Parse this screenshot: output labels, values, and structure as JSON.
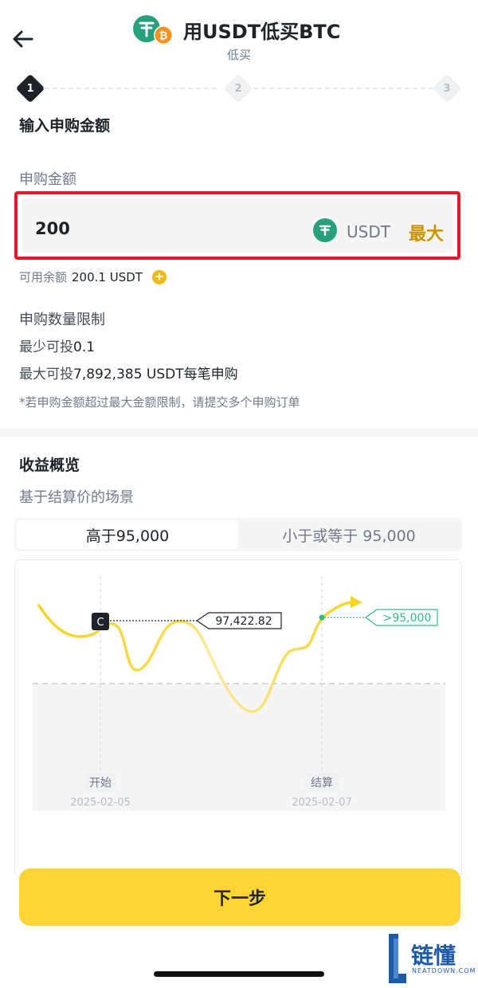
{
  "header": {
    "title": "用USDT低买BTC",
    "subtitle": "低买"
  },
  "stepper": {
    "steps": [
      "1",
      "2",
      "3"
    ],
    "active_step": 1
  },
  "form": {
    "section_title": "输入申购金额",
    "amount_label": "申购金额",
    "amount_value": "200",
    "currency": "USDT",
    "max_label": "最大",
    "available_label": "可用余额",
    "available_value": "200.1 USDT"
  },
  "limits": {
    "title": "申购数量限制",
    "min_label": "最少可投",
    "min_value": "0.1",
    "max_label": "最大可投",
    "max_value": "7,892,385 USDT每笔申购",
    "note": "*若申购金额超过最大金额限制，请提交多个申购订单"
  },
  "returns": {
    "title": "收益概览",
    "subtitle": "基于结算价的场景",
    "tabs": [
      "高于95,000",
      "小于或等于 95,000"
    ],
    "active_tab": 0
  },
  "chart_data": {
    "type": "line",
    "marker_label": "C",
    "price_label": "97,422.82",
    "target_label": ">95,000",
    "start_label": "开始",
    "start_date": "2025-02-05",
    "settle_label": "结算",
    "settle_date": "2025-02-07",
    "colors": {
      "line": "#f7d93e",
      "target": "#2ebd85",
      "threshold": "#c8ccd2"
    }
  },
  "actions": {
    "next_label": "下一步"
  },
  "watermark": {
    "text": "链懂",
    "sub": "NEATDOWN.COM"
  }
}
